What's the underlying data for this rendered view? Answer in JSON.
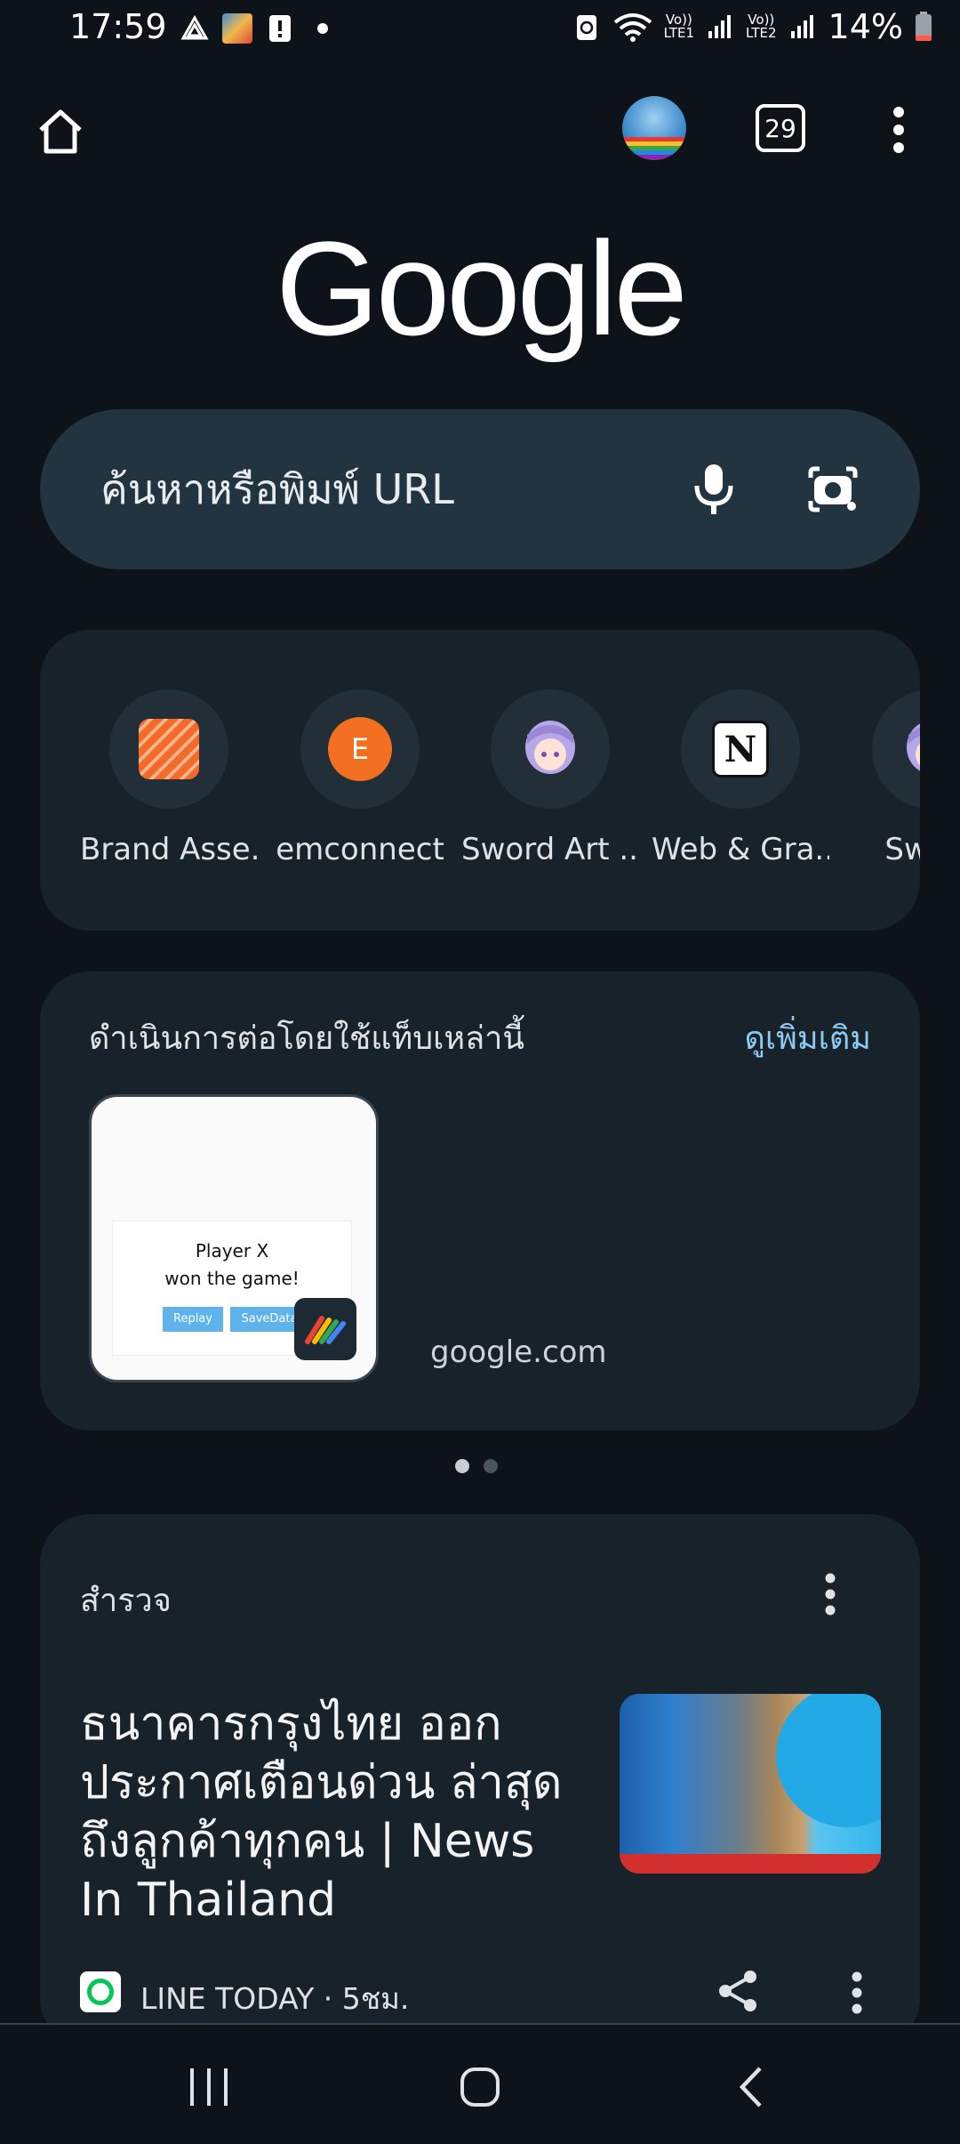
{
  "status_bar": {
    "time": "17:59",
    "lte1": "Vo))\nLTE1",
    "lte2": "Vo))\nLTE2",
    "battery": "14%"
  },
  "toolbar": {
    "tab_count": "29"
  },
  "logo": {
    "text": "Google"
  },
  "search": {
    "placeholder": "ค้นหาหรือพิมพ์ URL"
  },
  "shortcuts": [
    {
      "label": "Brand Asse...",
      "icon": "brand-assets-icon"
    },
    {
      "label": "emconnect",
      "letter": "E",
      "icon": "emconnect-icon"
    },
    {
      "label": "Sword Art ...",
      "icon": "anime-character-icon"
    },
    {
      "label": "Web & Gra...",
      "icon": "notion-icon",
      "letter": "N"
    },
    {
      "label": "Sword",
      "icon": "anime-character-icon"
    }
  ],
  "continue": {
    "title": "ดำเนินการต่อโดยใช้แท็บเหล่านี้",
    "see_more": "ดูเพิ่มเติม",
    "thumb": {
      "line1": "Player X",
      "line2": "won the game!",
      "btn1": "Replay",
      "btn2": "SaveData"
    },
    "site": "google.com"
  },
  "discover": {
    "title": "สำรวจ",
    "headline": "ธนาคารกรุงไทย ออกประกาศเตือนด่วน ล่าสุด ถึงลูกค้าทุกคน | News In Thailand",
    "source": "LINE TODAY · 5ชม."
  },
  "colors": {
    "background": "#0e1319",
    "card": "#18222b",
    "search": "#233441",
    "link": "#8ecbf2"
  }
}
